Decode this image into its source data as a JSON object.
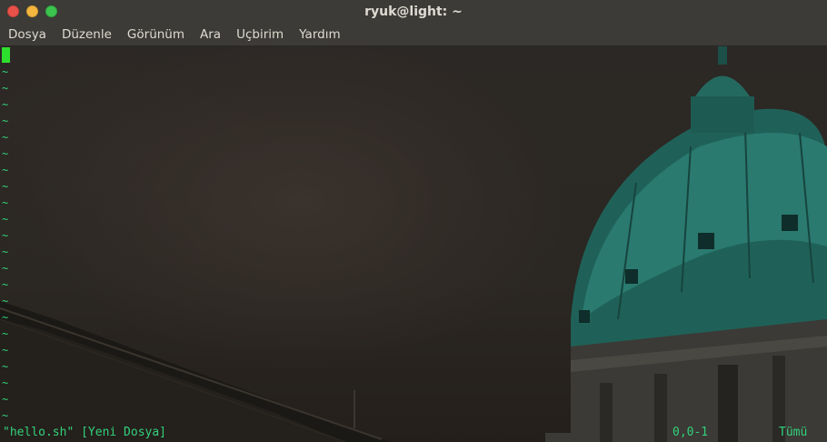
{
  "window": {
    "title": "ryuk@light: ~"
  },
  "menu": {
    "items": [
      "Dosya",
      "Düzenle",
      "Görünüm",
      "Ara",
      "Uçbirim",
      "Yardım"
    ]
  },
  "editor": {
    "tilde": "~",
    "status_file": "\"hello.sh\" [Yeni Dosya]",
    "cursor_position": "0,0-1",
    "scroll_position": "Tümü"
  },
  "colors": {
    "text_green": "#33d17a",
    "cursor_green": "#2ee02e",
    "titlebar": "#3c3b37",
    "close_button": "#e9524a",
    "minimize_button": "#f3b63f",
    "maximize_button": "#3dc44f"
  }
}
